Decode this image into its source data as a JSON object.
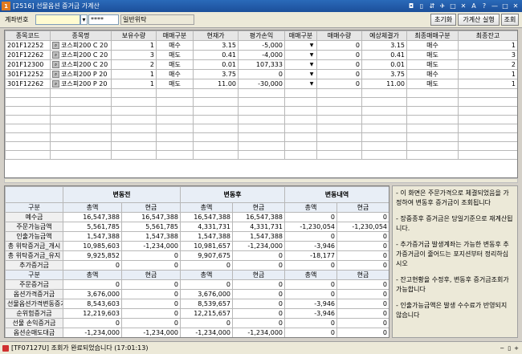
{
  "window": {
    "title": "[2516] 선물옵션 증거금 가계산",
    "icon_char": "1"
  },
  "window_controls": [
    "◘",
    "▯",
    "⇵",
    "✈",
    "□",
    "✕",
    "A",
    "?",
    "—",
    "□",
    "✕"
  ],
  "toolbar": {
    "account_label": "계좌번호",
    "account_value": "",
    "password_value": "****",
    "account_name": "일반위탁",
    "reset_label": "초기화",
    "calc_label": "가계산 실행",
    "query_label": "조회"
  },
  "positions": {
    "headers": [
      "종목코드",
      "종목명",
      "보유수량",
      "매매구분",
      "현재가",
      "평가손익",
      "매매구분",
      "매매수량",
      "예상체결가",
      "최종매매구분",
      "최종잔고"
    ],
    "rows": [
      {
        "code": "201F12252",
        "name": "코스피200 C 20",
        "qty": "1",
        "side": "매수",
        "price": "3.15",
        "pnl": "-5,000",
        "trade_side": "",
        "trade_qty": "0",
        "exp_price": "3.15",
        "final_side": "매수",
        "final_bal": "1"
      },
      {
        "code": "201F12262",
        "name": "코스피200 C 20",
        "qty": "3",
        "side": "매도",
        "price": "0.41",
        "pnl": "-4,000",
        "trade_side": "",
        "trade_qty": "0",
        "exp_price": "0.41",
        "final_side": "매도",
        "final_bal": "3"
      },
      {
        "code": "201F12300",
        "name": "코스피200 C 20",
        "qty": "2",
        "side": "매도",
        "price": "0.01",
        "pnl": "107,333",
        "trade_side": "",
        "trade_qty": "0",
        "exp_price": "0.01",
        "final_side": "매도",
        "final_bal": "2"
      },
      {
        "code": "301F12252",
        "name": "코스피200 P 20",
        "qty": "1",
        "side": "매수",
        "price": "3.75",
        "pnl": "0",
        "trade_side": "",
        "trade_qty": "0",
        "exp_price": "3.75",
        "final_side": "매수",
        "final_bal": "1"
      },
      {
        "code": "301F12262",
        "name": "코스피200 P 20",
        "qty": "1",
        "side": "매도",
        "price": "11.00",
        "pnl": "-30,000",
        "trade_side": "",
        "trade_qty": "0",
        "exp_price": "11.00",
        "final_side": "매도",
        "final_bal": "1"
      }
    ]
  },
  "summary": {
    "groups": [
      "변동전",
      "변동후",
      "변동내역"
    ],
    "sub1": [
      "구분",
      "총액",
      "현금",
      "총액",
      "현금",
      "총액",
      "현금"
    ],
    "rows1": [
      [
        "예수금",
        "16,547,388",
        "16,547,388",
        "16,547,388",
        "16,547,388",
        "0",
        "0"
      ],
      [
        "주문가능금액",
        "5,561,785",
        "5,561,785",
        "4,331,731",
        "4,331,731",
        "-1,230,054",
        "-1,230,054"
      ],
      [
        "인출가능금액",
        "1,547,388",
        "1,547,388",
        "1,547,388",
        "1,547,388",
        "0",
        "0"
      ],
      [
        "총 위탁증거금_개시",
        "10,985,603",
        "-1,234,000",
        "10,981,657",
        "-1,234,000",
        "-3,946",
        "0"
      ],
      [
        "총 위탁증거금_유지",
        "9,925,852",
        "0",
        "9,907,675",
        "0",
        "-18,177",
        "0"
      ],
      [
        "추가증거금",
        "0",
        "0",
        "0",
        "0",
        "0",
        "0"
      ]
    ],
    "sub2": [
      "구분",
      "총액",
      "현금",
      "총액",
      "현금",
      "총액",
      "현금"
    ],
    "rows2": [
      [
        "주문증거금",
        "0",
        "0",
        "0",
        "0",
        "0",
        "0"
      ],
      [
        "옵션가격증거금",
        "3,676,000",
        "0",
        "3,676,000",
        "0",
        "0",
        "0"
      ],
      [
        "선물옵션가격변동증거금",
        "8,543,603",
        "0",
        "8,539,657",
        "0",
        "-3,946",
        "0"
      ],
      [
        "순위험증거금",
        "12,219,603",
        "0",
        "12,215,657",
        "0",
        "-3,946",
        "0"
      ],
      [
        "선물 손익증거금",
        "0",
        "0",
        "0",
        "0",
        "0",
        "0"
      ],
      [
        "옵션순매도대금",
        "-1,234,000",
        "-1,234,000",
        "-1,234,000",
        "-1,234,000",
        "0",
        "0"
      ]
    ]
  },
  "notes": [
    "- 이 화면은 주문가격으로 체결되었음을 가정하여 변동후 증거금이 조회됩니다",
    "- 장중종후 증거금은 당일기준으로 재계산됩니다.",
    "- 추가증거금 발생계좌는 가능한 변동후 추가증거금이 줄어드는 포지션부터 정리하십시오",
    "- 잔고현황을 수정후, 변동후 증거금조회가 가능합니다",
    "- 인출가능금액은 발생 수수료가 반영되지 않습니다"
  ],
  "status": {
    "message": "[TF07127U] 조회가 완료되었습니다 (17:01:13)",
    "zoom": [
      "−",
      "▯",
      "+"
    ]
  }
}
